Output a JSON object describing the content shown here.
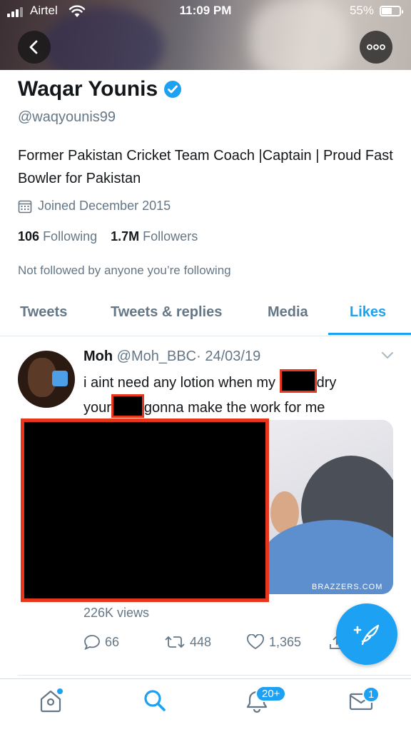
{
  "status_bar": {
    "carrier": "Airtel",
    "time": "11:09 PM",
    "battery": "55%",
    "battery_level": 0.55
  },
  "profile": {
    "name": "Waqar Younis",
    "handle": "@waqyounis99",
    "bio": "Former Pakistan Cricket Team Coach |Captain | Proud Fast Bowler for Pakistan",
    "joined": "Joined December 2015",
    "following_count": "106",
    "following_label": "Following",
    "followers_count": "1.7M",
    "followers_label": "Followers",
    "not_followed": "Not followed by anyone you’re following"
  },
  "tabs": [
    {
      "label": "Tweets"
    },
    {
      "label": "Tweets & replies"
    },
    {
      "label": "Media"
    },
    {
      "label": "Likes",
      "active": true
    }
  ],
  "tweet": {
    "author_name": "Moh",
    "author_handle": "@Moh_BBC",
    "separator": "·",
    "date": "24/03/19",
    "text_part1": "i aint need any lotion when my",
    "text_part2": "dry",
    "text_part3": "your",
    "text_part4": "gonna make the work for me",
    "media_watermark": "BRAZZERS.COM",
    "views": "226K views",
    "replies": "66",
    "retweets": "448",
    "likes": "1,365"
  },
  "nav": {
    "notifications_badge": "20+",
    "messages_badge": "1"
  },
  "colors": {
    "accent": "#1da1f2",
    "redaction_border": "#e8361c",
    "muted": "#657786"
  }
}
